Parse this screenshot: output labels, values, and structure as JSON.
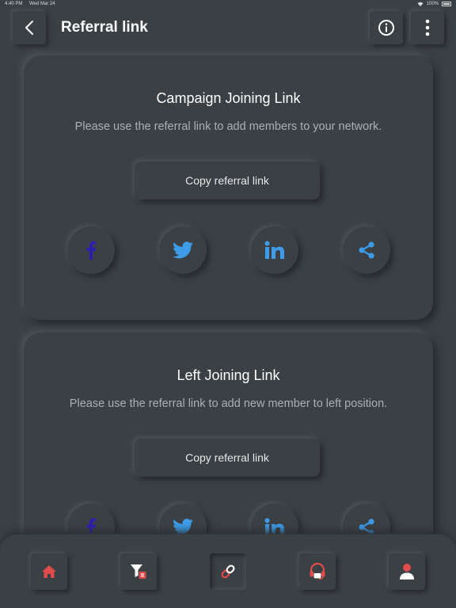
{
  "status_bar": {
    "time": "4:40 PM",
    "date": "Wed Mar 24",
    "battery": "100%"
  },
  "header": {
    "title": "Referral link"
  },
  "cards": [
    {
      "title": "Campaign Joining Link",
      "description": "Please use the referral link to add members to your network.",
      "copy_label": "Copy referral link"
    },
    {
      "title": "Left Joining Link",
      "description": "Please use the referral link to add new member to left position.",
      "copy_label": "Copy referral link"
    }
  ],
  "share_icons": [
    "facebook-icon",
    "twitter-icon",
    "linkedin-icon",
    "share-icon"
  ],
  "nav": {
    "items": [
      "home-icon",
      "filter-icon",
      "link-icon",
      "headset-icon",
      "user-icon"
    ],
    "active": "link-icon"
  },
  "colors": {
    "background": "#3b4045",
    "accent_red": "#e04b4b",
    "facebook": "#2c1fb0",
    "social_blue": "#3d9be8"
  }
}
